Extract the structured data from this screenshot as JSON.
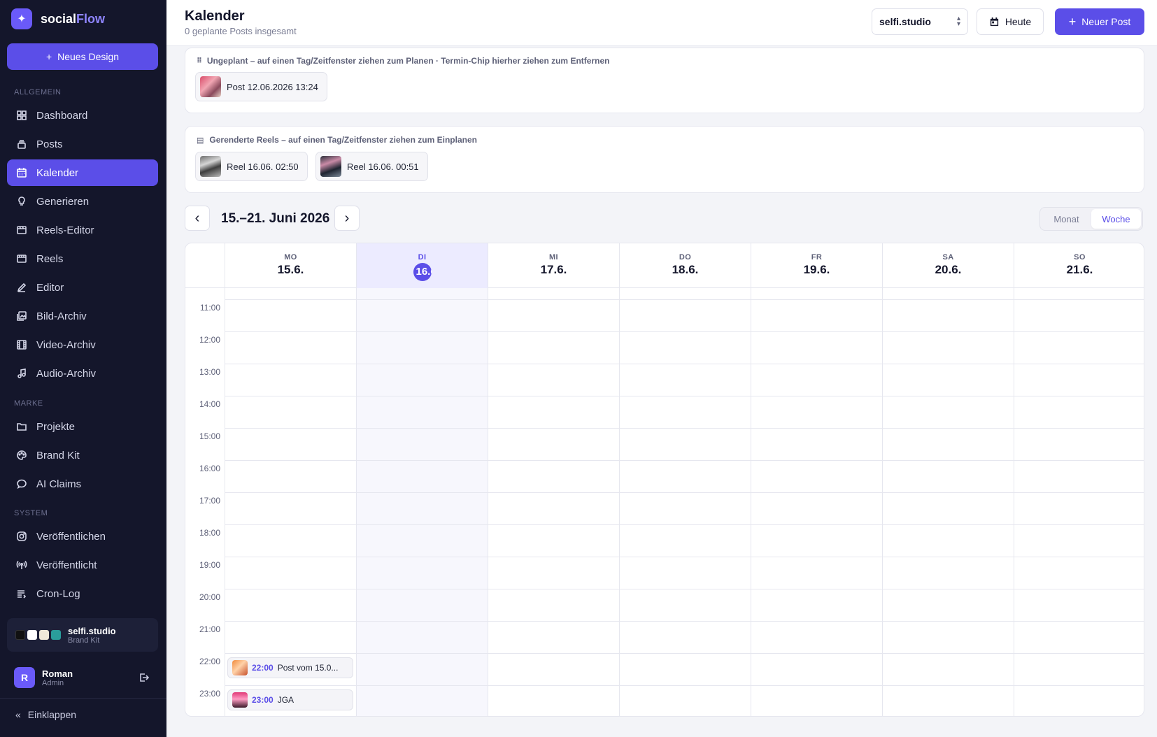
{
  "app": {
    "name_main": "social",
    "name_accent": "Flow"
  },
  "sidebar": {
    "new_design": "Neues Design",
    "sections": {
      "general": "ALLGEMEIN",
      "brand": "MARKE",
      "system": "SYSTEM"
    },
    "items": [
      {
        "label": "Dashboard",
        "icon": "grid-icon"
      },
      {
        "label": "Posts",
        "icon": "stack-icon"
      },
      {
        "label": "Kalender",
        "icon": "calendar-icon"
      },
      {
        "label": "Generieren",
        "icon": "lightbulb-icon"
      },
      {
        "label": "Reels-Editor",
        "icon": "film-edit-icon"
      },
      {
        "label": "Reels",
        "icon": "film-icon"
      },
      {
        "label": "Editor",
        "icon": "pen-icon"
      },
      {
        "label": "Bild-Archiv",
        "icon": "image-archive-icon"
      },
      {
        "label": "Video-Archiv",
        "icon": "video-archive-icon"
      },
      {
        "label": "Audio-Archiv",
        "icon": "music-icon"
      },
      {
        "label": "Projekte",
        "icon": "folder-icon"
      },
      {
        "label": "Brand Kit",
        "icon": "palette-icon"
      },
      {
        "label": "AI Claims",
        "icon": "chat-icon"
      },
      {
        "label": "Veröffentlichen",
        "icon": "instagram-icon"
      },
      {
        "label": "Veröffentlicht",
        "icon": "broadcast-icon"
      },
      {
        "label": "Cron-Log",
        "icon": "list-icon"
      }
    ],
    "active_item": "Kalender",
    "brand_card": {
      "name": "selfi.studio",
      "sub": "Brand Kit",
      "swatches": [
        "#111111",
        "#ffffff",
        "#efe8da",
        "#2a9d9b"
      ]
    },
    "user": {
      "initial": "R",
      "name": "Roman",
      "role": "Admin"
    },
    "collapse": "Einklappen"
  },
  "header": {
    "title": "Kalender",
    "subtitle": "0 geplante Posts insgesamt",
    "brand_select": "selfi.studio",
    "today": "Heute",
    "new_post": "Neuer Post"
  },
  "unscheduled": {
    "label": "Ungeplant – auf einen Tag/Zeitfenster ziehen zum Planen · Termin-Chip hierher ziehen zum Entfernen",
    "chips": [
      {
        "label": "Post 12.06.2026 13:24"
      }
    ]
  },
  "reels": {
    "label": "Gerenderte Reels – auf einen Tag/Zeitfenster ziehen zum Einplanen",
    "chips": [
      {
        "label": "Reel 16.06. 02:50"
      },
      {
        "label": "Reel 16.06. 00:51"
      }
    ]
  },
  "week": {
    "title": "15.–21. Juni 2026",
    "prev": "‹",
    "next": "›",
    "views": [
      "Monat",
      "Woche"
    ],
    "active_view": "Woche",
    "days": [
      {
        "dow": "MO",
        "date": "15.6."
      },
      {
        "dow": "DI",
        "date": "16.6."
      },
      {
        "dow": "MI",
        "date": "17.6."
      },
      {
        "dow": "DO",
        "date": "18.6."
      },
      {
        "dow": "FR",
        "date": "19.6."
      },
      {
        "dow": "SA",
        "date": "20.6."
      },
      {
        "dow": "SO",
        "date": "21.6."
      }
    ],
    "today_index": 1,
    "hours": [
      "11:00",
      "12:00",
      "13:00",
      "14:00",
      "15:00",
      "16:00",
      "17:00",
      "18:00",
      "19:00",
      "20:00",
      "21:00",
      "22:00",
      "23:00"
    ],
    "events": [
      {
        "day": 0,
        "time": "22:00",
        "title": "Post vom 15.0..."
      },
      {
        "day": 0,
        "time": "23:00",
        "title": "JGA"
      }
    ]
  }
}
